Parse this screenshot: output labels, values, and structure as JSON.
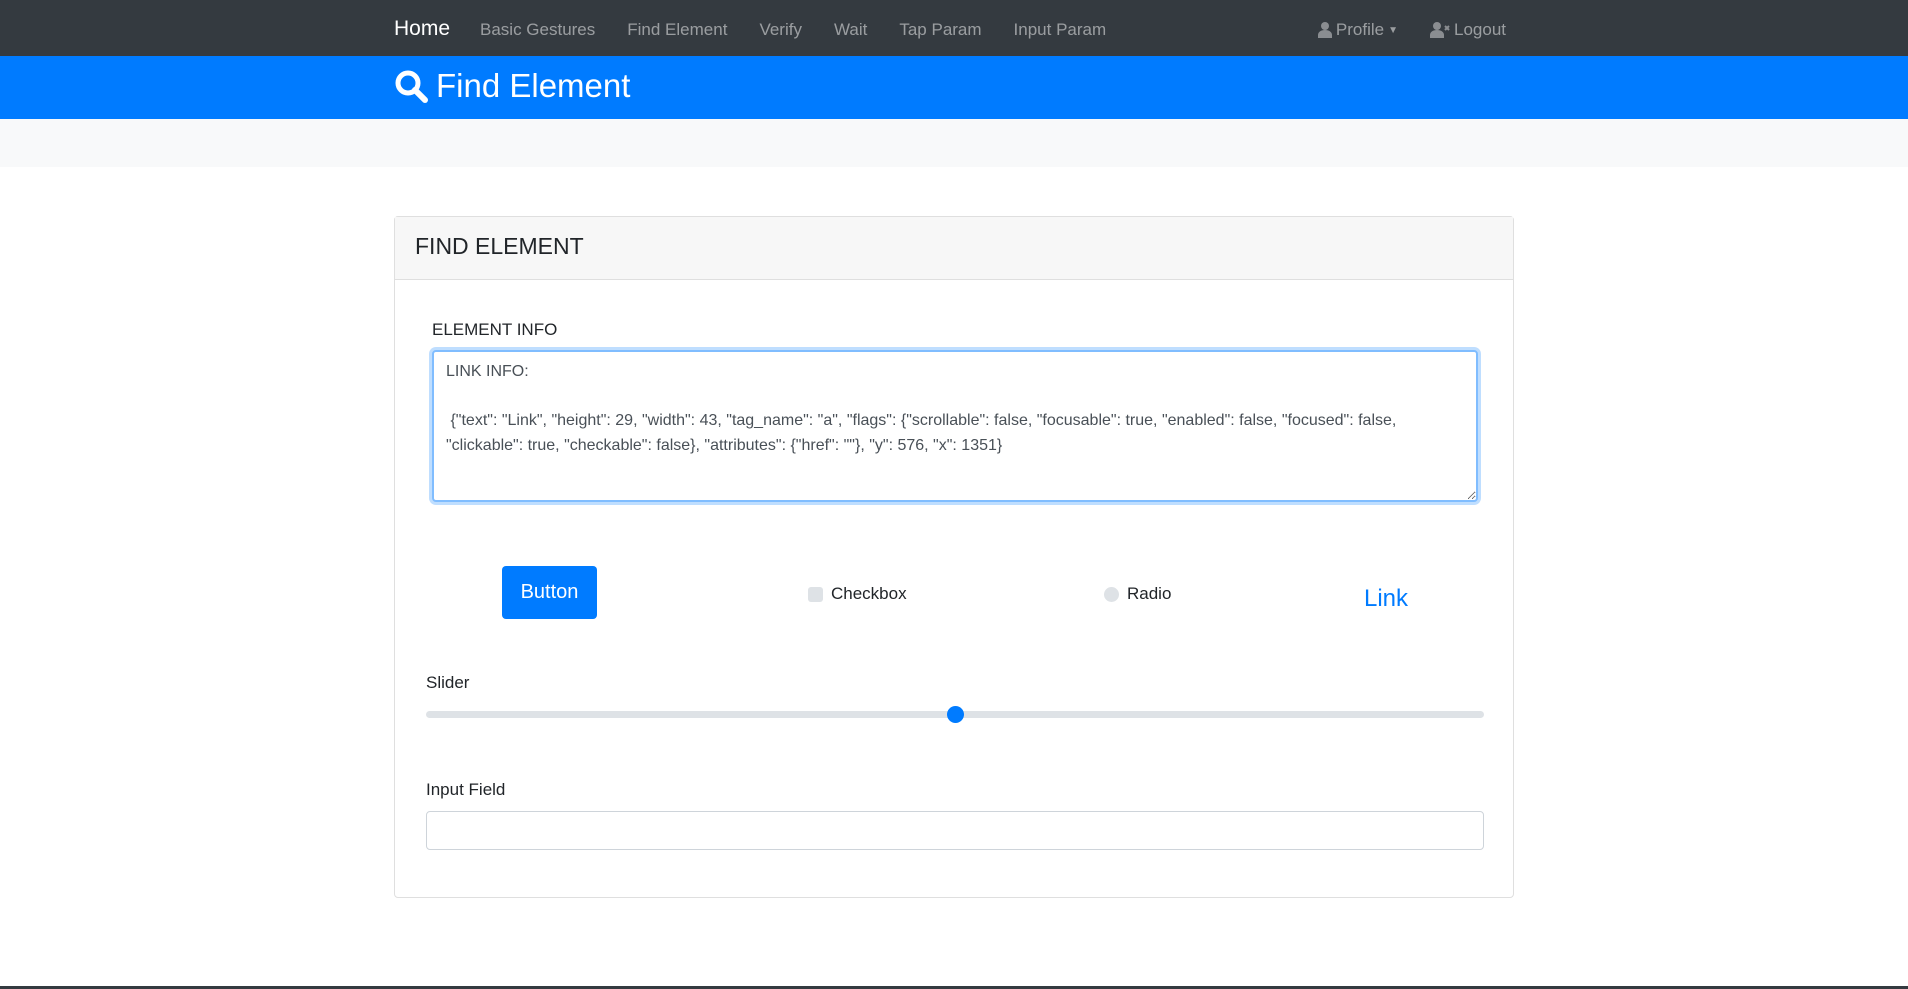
{
  "nav": {
    "brand": "Home",
    "links": [
      "Basic Gestures",
      "Find Element",
      "Verify",
      "Wait",
      "Tap Param",
      "Input Param"
    ],
    "profile": "Profile",
    "logout": "Logout"
  },
  "hero": {
    "title": "Find Element",
    "icon": "search-icon"
  },
  "card": {
    "title": "FIND ELEMENT",
    "element_info_label": "ELEMENT INFO",
    "element_info_value": "LINK INFO:\n\n {\"text\": \"Link\", \"height\": 29, \"width\": 43, \"tag_name\": \"a\", \"flags\": {\"scrollable\": false, \"focusable\": true, \"enabled\": false, \"focused\": false, \"clickable\": true, \"checkable\": false}, \"attributes\": {\"href\": \"\"}, \"y\": 576, \"x\": 1351}",
    "button_label": "Button",
    "checkbox_label": "Checkbox",
    "checkbox_checked": false,
    "radio_label": "Radio",
    "radio_checked": false,
    "link_label": "Link",
    "slider_label": "Slider",
    "slider_value_percent": 50,
    "input_label": "Input Field",
    "input_value": ""
  },
  "colors": {
    "primary": "#007bff",
    "navbar": "#343a40"
  }
}
